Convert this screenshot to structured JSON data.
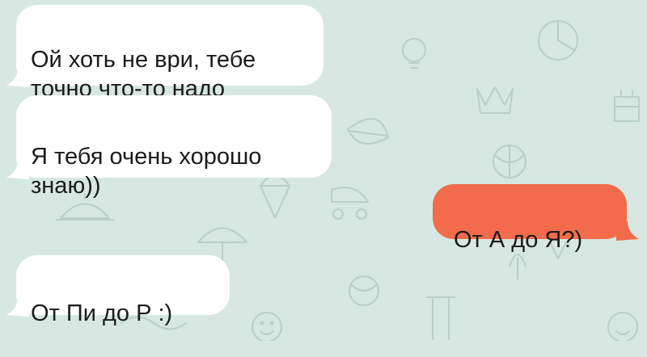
{
  "chat": {
    "background_color": "#d6e8e1",
    "incoming_color": "#ffffff",
    "outgoing_color": "#f26b4a",
    "messages": [
      {
        "direction": "incoming",
        "text": "Ой хоть не ври, тебе\nточно что-то надо"
      },
      {
        "direction": "incoming",
        "text": "Я тебя очень хорошо\nзнаю))"
      },
      {
        "direction": "outgoing",
        "text": "От А до Я?)"
      },
      {
        "direction": "incoming",
        "text": "От Пи до Р :)"
      }
    ]
  },
  "background_doodles": [
    "lightbulb-icon",
    "crown-icon",
    "cake-icon",
    "leaf-icon",
    "ball-icon",
    "umbrella-icon",
    "smile-icon",
    "cloche-icon",
    "ice-cream-icon",
    "pram-icon"
  ]
}
